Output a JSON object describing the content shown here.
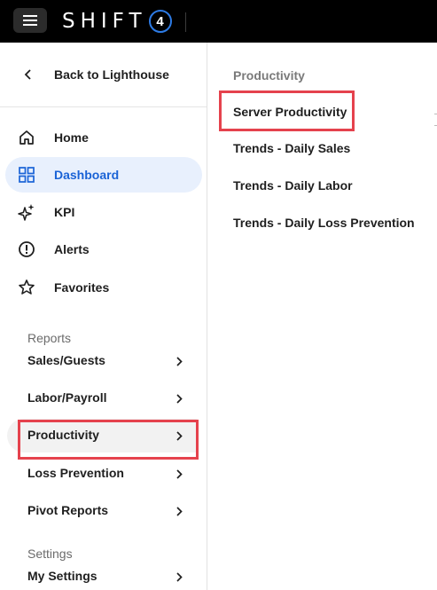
{
  "header": {
    "brand_text": "SHIFT",
    "brand_number": "4",
    "menu_icon": "hamburger-menu-icon"
  },
  "sidebar": {
    "back_label": "Back to Lighthouse",
    "nav_items": [
      {
        "label": "Home",
        "icon": "home-icon",
        "active": false
      },
      {
        "label": "Dashboard",
        "icon": "dashboard-grid-icon",
        "active": true
      },
      {
        "label": "KPI",
        "icon": "sparkles-icon",
        "active": false
      },
      {
        "label": "Alerts",
        "icon": "alert-circle-icon",
        "active": false
      },
      {
        "label": "Favorites",
        "icon": "star-icon",
        "active": false
      }
    ],
    "reports_label": "Reports",
    "reports": [
      {
        "label": "Sales/Guests"
      },
      {
        "label": "Labor/Payroll"
      },
      {
        "label": "Productivity",
        "selected": true
      },
      {
        "label": "Loss Prevention"
      },
      {
        "label": "Pivot Reports"
      }
    ],
    "settings_label": "Settings",
    "settings": [
      {
        "label": "My Settings"
      }
    ]
  },
  "submenu": {
    "title": "Productivity",
    "items": [
      {
        "label": "Server Productivity",
        "highlighted": true
      },
      {
        "label": "Trends - Daily Sales"
      },
      {
        "label": "Trends - Daily Labor"
      },
      {
        "label": "Trends - Daily Loss Prevention"
      }
    ]
  },
  "colors": {
    "topbar": "#000000",
    "accent_blue": "#1a63d6",
    "active_bg": "#e8f0fd",
    "highlight_red": "#e5424d"
  }
}
